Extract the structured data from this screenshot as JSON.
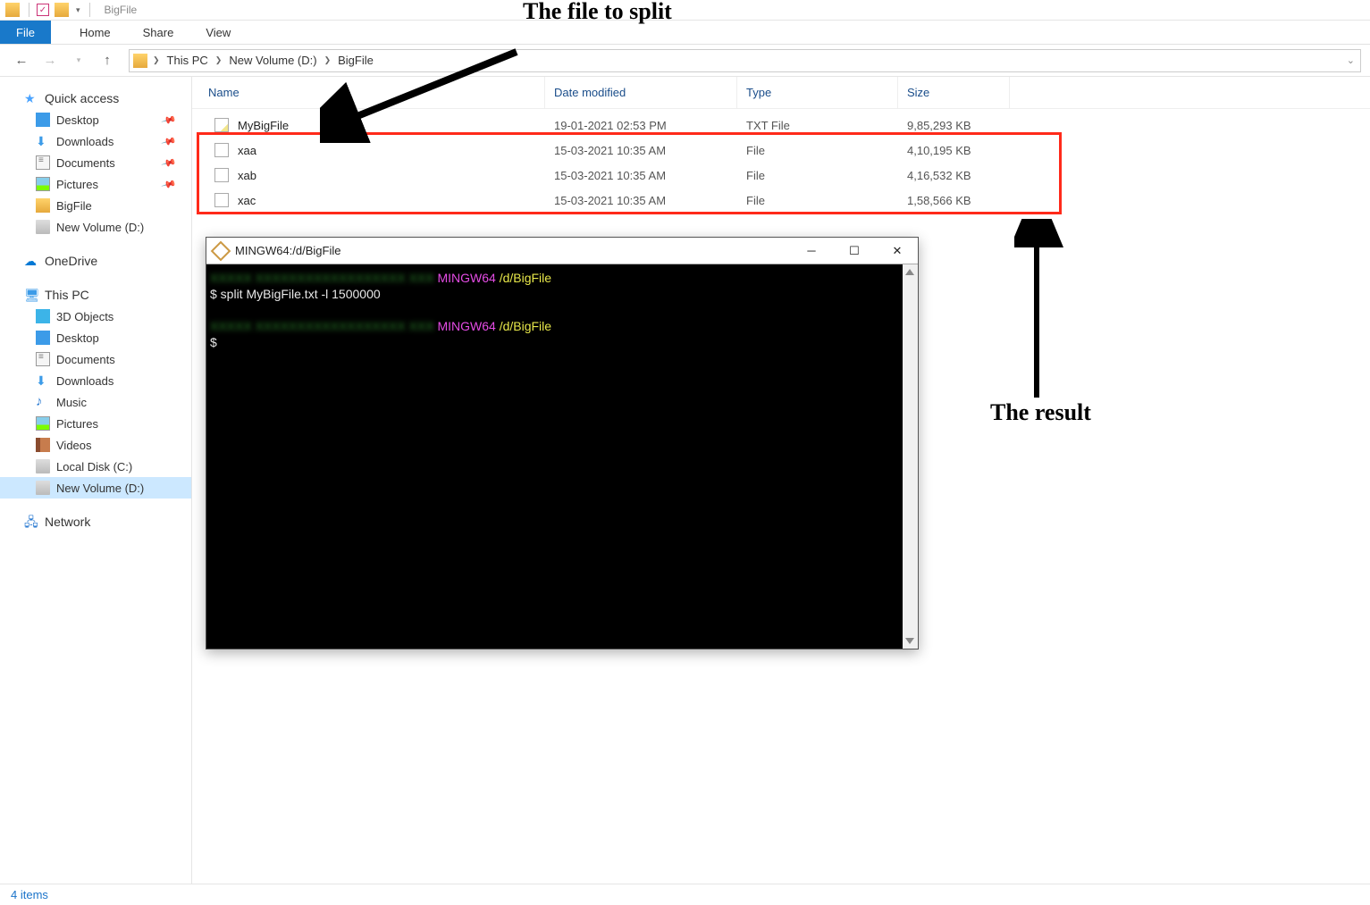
{
  "title": "BigFile",
  "ribbon": {
    "file": "File",
    "tabs": [
      "Home",
      "Share",
      "View"
    ]
  },
  "breadcrumbs": [
    "This PC",
    "New Volume (D:)",
    "BigFile"
  ],
  "columns": {
    "name": "Name",
    "date": "Date modified",
    "type": "Type",
    "size": "Size"
  },
  "files": [
    {
      "name": "MyBigFile",
      "date": "19-01-2021 02:53 PM",
      "type": "TXT File",
      "size": "9,85,293 KB",
      "icon": "txt"
    },
    {
      "name": "xaa",
      "date": "15-03-2021 10:35 AM",
      "type": "File",
      "size": "4,10,195 KB",
      "icon": "file"
    },
    {
      "name": "xab",
      "date": "15-03-2021 10:35 AM",
      "type": "File",
      "size": "4,16,532 KB",
      "icon": "file"
    },
    {
      "name": "xac",
      "date": "15-03-2021 10:35 AM",
      "type": "File",
      "size": "1,58,566 KB",
      "icon": "file"
    }
  ],
  "sidebar": {
    "quickAccess": {
      "label": "Quick access",
      "items": [
        {
          "label": "Desktop",
          "icon": "desk",
          "pinned": true
        },
        {
          "label": "Downloads",
          "icon": "dl",
          "pinned": true
        },
        {
          "label": "Documents",
          "icon": "doc",
          "pinned": true
        },
        {
          "label": "Pictures",
          "icon": "pic",
          "pinned": true
        },
        {
          "label": "BigFile",
          "icon": "folder",
          "pinned": false
        },
        {
          "label": "New Volume (D:)",
          "icon": "drive",
          "pinned": false
        }
      ]
    },
    "onedrive": {
      "label": "OneDrive"
    },
    "thisPC": {
      "label": "This PC",
      "items": [
        {
          "label": "3D Objects",
          "icon": "3d"
        },
        {
          "label": "Desktop",
          "icon": "desk"
        },
        {
          "label": "Documents",
          "icon": "doc"
        },
        {
          "label": "Downloads",
          "icon": "dl"
        },
        {
          "label": "Music",
          "icon": "music"
        },
        {
          "label": "Pictures",
          "icon": "pic"
        },
        {
          "label": "Videos",
          "icon": "video"
        },
        {
          "label": "Local Disk (C:)",
          "icon": "drive"
        },
        {
          "label": "New Volume (D:)",
          "icon": "drive",
          "selected": true
        }
      ]
    },
    "network": {
      "label": "Network"
    }
  },
  "terminal": {
    "title": "MINGW64:/d/BigFile",
    "lines": [
      {
        "blurUser": "XXXXX XXXXXXXXXXXXXXXXXX XXX",
        "env": "MINGW64",
        "path": "/d/BigFile"
      },
      {
        "cmd": "$ split MyBigFile.txt -l 1500000"
      },
      {
        "blank": true
      },
      {
        "blurUser": "XXXXX XXXXXXXXXXXXXXXXXX XXX",
        "env": "MINGW64",
        "path": "/d/BigFile"
      },
      {
        "cmd": "$ "
      }
    ]
  },
  "status": "4 items",
  "annotations": {
    "split": "The file to split",
    "result": "The result"
  }
}
